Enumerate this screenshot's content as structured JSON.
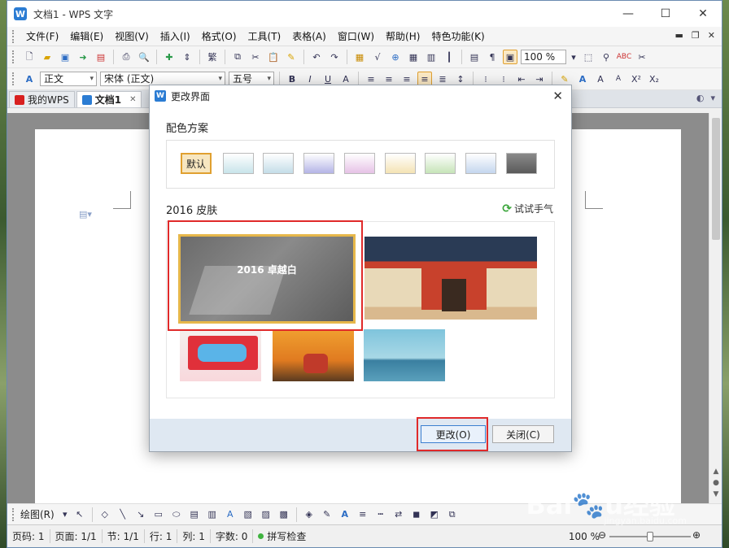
{
  "window": {
    "title": "文档1 - WPS 文字",
    "app_icon": "W"
  },
  "menubar": {
    "items": [
      "文件(F)",
      "编辑(E)",
      "视图(V)",
      "插入(I)",
      "格式(O)",
      "工具(T)",
      "表格(A)",
      "窗口(W)",
      "帮助(H)",
      "特色功能(K)"
    ]
  },
  "toolbar": {
    "zoom": "100 %",
    "style": "正文",
    "font": "宋体 (正文)",
    "size": "五号",
    "font_char": "繁"
  },
  "tabs": [
    {
      "label": "我的WPS"
    },
    {
      "label": "文档1"
    }
  ],
  "dialog": {
    "title": "更改界面",
    "color_scheme_label": "配色方案",
    "default_swatch": "默认",
    "swatch_colors": [
      "#c8e4ea",
      "#c4dde8",
      "#b4b4e6",
      "#e6c2e6",
      "#f4e3b4",
      "#c6e4b8",
      "#c4d6ee",
      "#5a5a5a"
    ],
    "skin_section_label": "2016 皮肤",
    "refresh_label": "试试手气",
    "selected_skin": "2016 卓越白",
    "apply_button": "更改(O)",
    "close_button": "关闭(C)"
  },
  "drawbar": {
    "label": "绘图(R)"
  },
  "statusbar": {
    "page": "页码: 1",
    "pages": "页面: 1/1",
    "section": "节: 1/1",
    "row": "行: 1",
    "col": "列: 1",
    "words": "字数: 0",
    "spell": "拼写检查",
    "zoom": "100 %"
  }
}
